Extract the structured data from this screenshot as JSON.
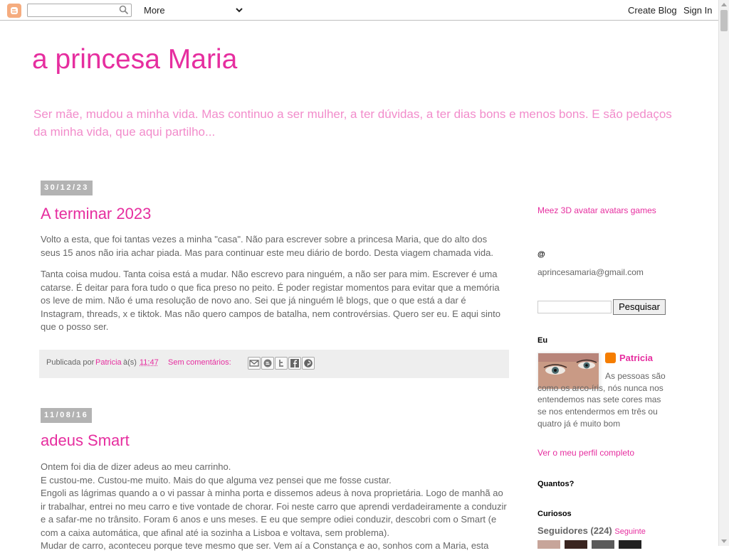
{
  "navbar": {
    "search_placeholder": "",
    "more_label": "More",
    "create_blog": "Create Blog",
    "sign_in": "Sign In"
  },
  "header": {
    "title": "a princesa Maria",
    "description": "Ser mãe, mudou a minha vida. Mas continuo a ser mulher, a ter dúvidas, a ter dias bons e menos bons. E são pedaços da minha vida, que aqui partilho..."
  },
  "posts": [
    {
      "date": "30/12/23",
      "title": "A terminar 2023",
      "paragraphs": [
        "Volto a esta, que foi tantas vezes a minha \"casa\". Não para escrever sobre a princesa Maria, que do alto dos seus 15 anos não iria achar piada. Mas para continuar este meu diário de bordo. Desta viagem chamada vida.",
        "Tanta coisa mudou. Tanta coisa está a mudar. Não escrevo para ninguém, a não ser para mim. Escrever é uma catarse. É deitar para fora tudo o que fica preso no peito. É poder registar momentos para evitar que a memória os leve de mim. Não é uma resolução de novo ano. Sei que já ninguém lê blogs, que o que está a dar é Instagram, threads, x e tiktok. Mas não quero campos de batalha, nem controvérsias. Quero ser eu. E aqui sinto que o posso ser."
      ],
      "footer": {
        "published_by": "Publicada por",
        "author": "Patricia",
        "at": "à(s)",
        "time": "11:47",
        "comments": "Sem comentários:"
      }
    },
    {
      "date": "11/08/16",
      "title": "adeus Smart",
      "lines": [
        "Ontem foi dia de dizer adeus ao meu carrinho.",
        "E custou-me. Custou-me muito. Mais do que alguma vez pensei que me fosse custar.",
        "Engoli as lágrimas quando a o vi passar à minha porta e dissemos adeus à nova proprietária. Logo de manhã ao ir trabalhar, entrei no meu carro e tive vontade de chorar. Foi neste carro que aprendi verdadeiramente a conduzir e a safar-me no trânsito. Foram 6 anos e uns meses. E eu que sempre odiei conduzir, descobri com o Smart (e com a caixa automática, que afinal até ia sozinha a Lisboa e voltava, sem problema).",
        "Mudar de carro, aconteceu porque teve mesmo que ser. Vem aí a Constança e ao, sonhos com a Maria, esta"
      ]
    }
  ],
  "sidebar": {
    "avatar_alt": "Meez 3D avatar avatars games",
    "email_heading": "@",
    "email": "aprincesamaria@gmail.com",
    "search_button": "Pesquisar",
    "about_heading": "Eu",
    "profile_name": "Patricia",
    "profile_about_line1": "As pessoas são como os arco-íris, nós nunca nos entendemos nas sete cores mas se nos entendermos em três ou quatro já é muito bom",
    "profile_link": "Ver o meu perfil completo",
    "counter_heading": "Quantos?",
    "followers_heading": "Curiosos",
    "followers_label": "Seguidores (224)",
    "follow_link": "Seguinte"
  },
  "colors": {
    "accent": "#e62e9f",
    "desc": "#f28ccb",
    "date_bg": "#b3b3b3",
    "footer_bg": "#eeeeee"
  }
}
